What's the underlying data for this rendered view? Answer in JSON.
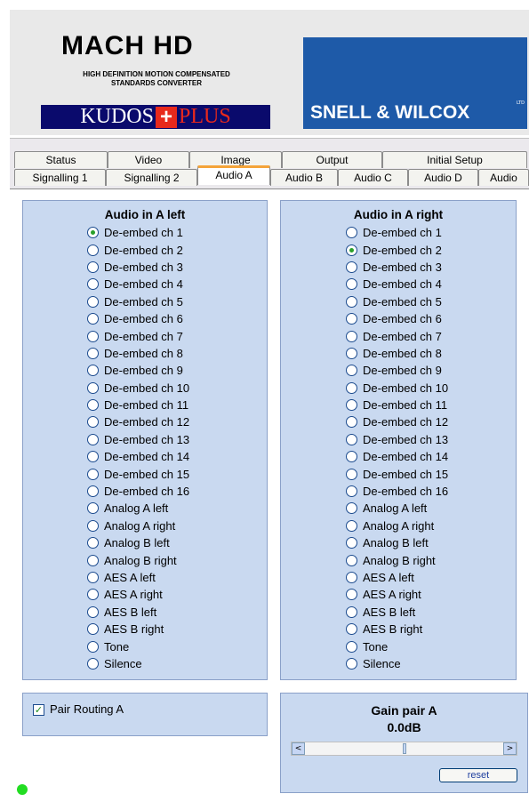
{
  "header": {
    "title": "MACH HD",
    "subtitle_line1": "HIGH DEFINITION MOTION COMPENSATED",
    "subtitle_line2": "STANDARDS CONVERTER",
    "kudos_left": "KUDOS",
    "kudos_cross": "+",
    "kudos_right": "PLUS",
    "brand": "SNELL & WILCOX",
    "trademark": "LTD"
  },
  "tabs_row1": [
    "Status",
    "Video",
    "Image",
    "Output",
    "Initial Setup"
  ],
  "tabs_row2": [
    "Signalling 1",
    "Signalling 2",
    "Audio A",
    "Audio B",
    "Audio C",
    "Audio D",
    "Audio"
  ],
  "active_tab": "Audio A",
  "left_group": {
    "title": "Audio in A left",
    "selected_index": 0
  },
  "right_group": {
    "title": "Audio in A right",
    "selected_index": 1
  },
  "options": [
    "De-embed ch  1",
    "De-embed ch  2",
    "De-embed ch  3",
    "De-embed ch  4",
    "De-embed ch  5",
    "De-embed ch  6",
    "De-embed ch  7",
    "De-embed ch  8",
    "De-embed ch  9",
    "De-embed ch 10",
    "De-embed ch 11",
    "De-embed ch 12",
    "De-embed ch 13",
    "De-embed ch 14",
    "De-embed ch 15",
    "De-embed ch 16",
    "Analog A left",
    "Analog A right",
    "Analog B left",
    "Analog B right",
    "AES A left",
    "AES A right",
    "AES B left",
    "AES B right",
    "Tone",
    "Silence"
  ],
  "pair_routing": {
    "label": "Pair Routing A",
    "checked": true,
    "mark": "✓"
  },
  "gain": {
    "title": "Gain pair A",
    "value": "0.0dB",
    "slider_position": 0.5,
    "left_arrow": "<",
    "right_arrow": ">",
    "reset_label": "reset"
  },
  "colors": {
    "panel_bg": "#c9d9f0",
    "active_tab_accent": "#f4a43a",
    "status_dot": "#22dd22",
    "brand_blue": "#1e5aa8",
    "kudos_navy": "#0a0a6c",
    "kudos_red": "#e8291c"
  }
}
